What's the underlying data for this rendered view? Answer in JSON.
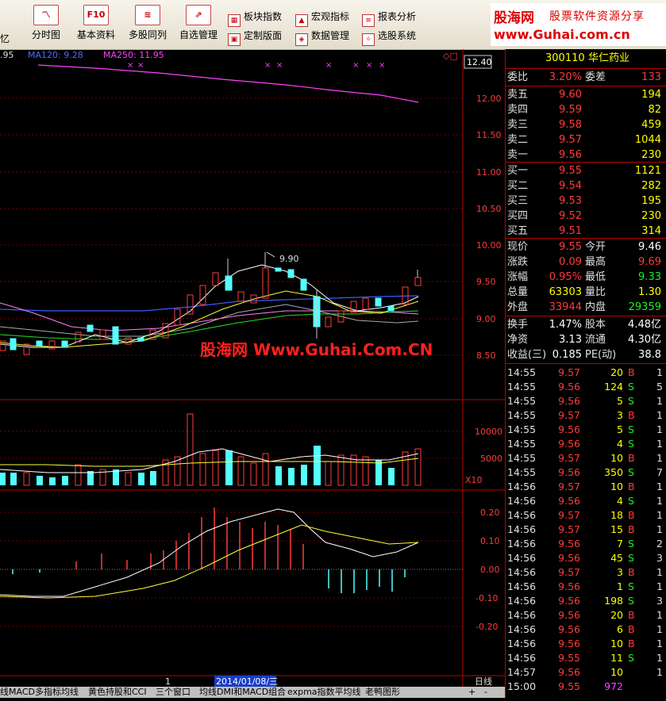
{
  "toolbar": {
    "left_cut": "忆",
    "big": [
      {
        "label": "分时图",
        "icon": "intraday-chart-icon"
      },
      {
        "label": "基本资料",
        "icon": "f10-icon",
        "icon_text": "F10"
      },
      {
        "label": "多股同列",
        "icon": "multi-stock-icon"
      },
      {
        "label": "自选管理",
        "icon": "watchlist-icon"
      }
    ],
    "small": [
      {
        "label": "板块指数",
        "icon": "sector-index-icon"
      },
      {
        "label": "宏观指标",
        "icon": "macro-icon"
      },
      {
        "label": "报表分析",
        "icon": "report-icon"
      },
      {
        "label": "定制版面",
        "icon": "layout-icon"
      },
      {
        "label": "数据管理",
        "icon": "data-icon"
      },
      {
        "label": "选股系统",
        "icon": "screener-icon"
      }
    ],
    "logo": {
      "line1": "股海网",
      "line1b": "股票软件资源分享",
      "line2": "www.Guhai.com.cn"
    }
  },
  "chart": {
    "ma_header": {
      "left": ".95",
      "ma120": "MA120: 9.28",
      "ma250": "MA250: 11.95"
    },
    "price_ticks": [
      "12.40",
      "12.00",
      "11.50",
      "11.00",
      "10.50",
      "10.00",
      "9.50",
      "9.00",
      "8.50"
    ],
    "high_label": "9.90",
    "watermark": "股海网 Www.Guhai.Com.CN",
    "volume_ticks": [
      "10000",
      "5000"
    ],
    "volume_unit": "X10",
    "macd_ticks": [
      "0.20",
      "0.10",
      "0.00",
      "-0.10",
      "-0.20"
    ],
    "date_marker": "2014/01/08/三",
    "cursor_mark": "1",
    "period": "日线"
  },
  "tabs": [
    "线MACD",
    "多指标均线",
    "黄色持股和CCI",
    "三个窗口",
    "均线DMI和MACD组合",
    "expma指数平均线",
    "老鸭图形"
  ],
  "tab_controls": [
    "+",
    "-"
  ],
  "quote": {
    "code": "300110",
    "name": "华仁药业",
    "weibi_label": "委比",
    "weibi": "3.20%",
    "weicha_label": "委差",
    "weicha": "133",
    "asks": [
      {
        "label": "卖五",
        "price": "9.60",
        "vol": "194"
      },
      {
        "label": "卖四",
        "price": "9.59",
        "vol": "82"
      },
      {
        "label": "卖三",
        "price": "9.58",
        "vol": "459"
      },
      {
        "label": "卖二",
        "price": "9.57",
        "vol": "1044"
      },
      {
        "label": "卖一",
        "price": "9.56",
        "vol": "230"
      }
    ],
    "bids": [
      {
        "label": "买一",
        "price": "9.55",
        "vol": "1121"
      },
      {
        "label": "买二",
        "price": "9.54",
        "vol": "282"
      },
      {
        "label": "买三",
        "price": "9.53",
        "vol": "195"
      },
      {
        "label": "买四",
        "price": "9.52",
        "vol": "230"
      },
      {
        "label": "买五",
        "price": "9.51",
        "vol": "314"
      }
    ],
    "stats": [
      {
        "l1": "现价",
        "v1": "9.55",
        "l2": "今开",
        "v2": "9.46",
        "c1": "#ff3b3b",
        "c2": "#ffffff"
      },
      {
        "l1": "涨跌",
        "v1": "0.09",
        "l2": "最高",
        "v2": "9.69",
        "c1": "#ff3b3b",
        "c2": "#ff3b3b"
      },
      {
        "l1": "涨幅",
        "v1": "0.95%",
        "l2": "最低",
        "v2": "9.33",
        "c1": "#ff3b3b",
        "c2": "#22ee22"
      },
      {
        "l1": "总量",
        "v1": "63303",
        "l2": "量比",
        "v2": "1.30",
        "c1": "#ffff00",
        "c2": "#ffff00"
      },
      {
        "l1": "外盘",
        "v1": "33944",
        "l2": "内盘",
        "v2": "29359",
        "c1": "#ff3b3b",
        "c2": "#22ee22"
      }
    ],
    "stats2": [
      {
        "l1": "换手",
        "v1": "1.47%",
        "l2": "股本",
        "v2": "4.48亿"
      },
      {
        "l1": "净资",
        "v1": "3.13",
        "l2": "流通",
        "v2": "4.30亿"
      },
      {
        "l1": "收益(三)",
        "v1": "0.185",
        "l2": "PE(动)",
        "v2": "38.8"
      }
    ],
    "ticks": [
      {
        "t": "14:55",
        "p": "9.57",
        "v": "20",
        "s": "B",
        "n": "1"
      },
      {
        "t": "14:55",
        "p": "9.56",
        "v": "124",
        "s": "S",
        "n": "5"
      },
      {
        "t": "14:55",
        "p": "9.56",
        "v": "5",
        "s": "S",
        "n": "1"
      },
      {
        "t": "14:55",
        "p": "9.57",
        "v": "3",
        "s": "B",
        "n": "1"
      },
      {
        "t": "14:55",
        "p": "9.56",
        "v": "5",
        "s": "S",
        "n": "1"
      },
      {
        "t": "14:55",
        "p": "9.56",
        "v": "4",
        "s": "S",
        "n": "1"
      },
      {
        "t": "14:55",
        "p": "9.57",
        "v": "10",
        "s": "B",
        "n": "1"
      },
      {
        "t": "14:55",
        "p": "9.56",
        "v": "350",
        "s": "S",
        "n": "7"
      },
      {
        "t": "14:56",
        "p": "9.57",
        "v": "10",
        "s": "B",
        "n": "1"
      },
      {
        "t": "14:56",
        "p": "9.56",
        "v": "4",
        "s": "S",
        "n": "1"
      },
      {
        "t": "14:56",
        "p": "9.57",
        "v": "18",
        "s": "B",
        "n": "1"
      },
      {
        "t": "14:56",
        "p": "9.57",
        "v": "15",
        "s": "B",
        "n": "1"
      },
      {
        "t": "14:56",
        "p": "9.56",
        "v": "7",
        "s": "S",
        "n": "2"
      },
      {
        "t": "14:56",
        "p": "9.56",
        "v": "45",
        "s": "S",
        "n": "3"
      },
      {
        "t": "14:56",
        "p": "9.57",
        "v": "3",
        "s": "B",
        "n": "1"
      },
      {
        "t": "14:56",
        "p": "9.56",
        "v": "1",
        "s": "S",
        "n": "1"
      },
      {
        "t": "14:56",
        "p": "9.56",
        "v": "198",
        "s": "S",
        "n": "3"
      },
      {
        "t": "14:56",
        "p": "9.56",
        "v": "20",
        "s": "B",
        "n": "1"
      },
      {
        "t": "14:56",
        "p": "9.56",
        "v": "6",
        "s": "B",
        "n": "1"
      },
      {
        "t": "14:56",
        "p": "9.56",
        "v": "10",
        "s": "B",
        "n": "1"
      },
      {
        "t": "14:56",
        "p": "9.55",
        "v": "11",
        "s": "S",
        "n": "1"
      },
      {
        "t": "14:57",
        "p": "9.56",
        "v": "10",
        "s": "",
        "n": "1"
      },
      {
        "t": "15:00",
        "p": "9.55",
        "v": "972",
        "s": "",
        "n": ""
      }
    ]
  },
  "colors": {
    "up": "#ff3b3b",
    "down": "#54ffff",
    "buy": "#ff3b3b",
    "sell": "#22ee22",
    "label": "#e0e0e0",
    "gold": "#ffff00"
  }
}
